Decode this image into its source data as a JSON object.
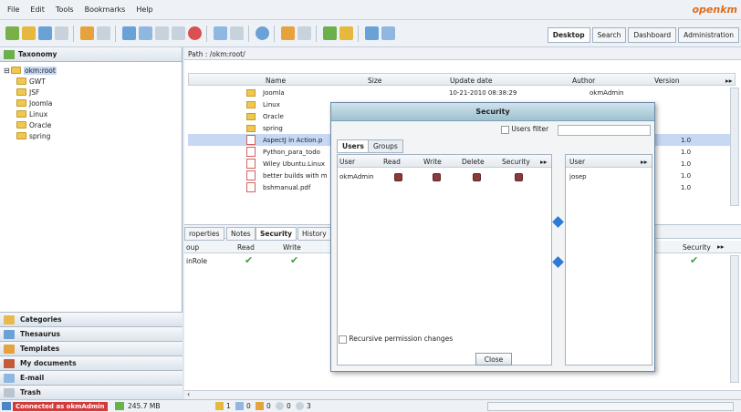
{
  "menu": [
    "File",
    "Edit",
    "Tools",
    "Bookmarks",
    "Help"
  ],
  "brand": "openkm",
  "top_tabs": [
    "Desktop",
    "Search",
    "Dashboard",
    "Administration"
  ],
  "left": {
    "taxonomy": "Taxonomy",
    "root": "okm:root",
    "folders": [
      "GWT",
      "JSF",
      "Joomla",
      "Linux",
      "Oracle",
      "spring"
    ],
    "accordion": [
      "Categories",
      "Thesaurus",
      "Templates",
      "My documents",
      "E-mail",
      "Trash"
    ]
  },
  "path": "Path : /okm:root/",
  "grid": {
    "headers": [
      "Name",
      "Size",
      "Update date",
      "Author",
      "Version"
    ],
    "rows": [
      {
        "name": "Joomla",
        "type": "folder",
        "date": "10-21-2010 08:38:29",
        "author": "okmAdmin",
        "version": ""
      },
      {
        "name": "Linux",
        "type": "folder",
        "date": "",
        "author": "",
        "version": ""
      },
      {
        "name": "Oracle",
        "type": "folder",
        "date": "",
        "author": "",
        "version": ""
      },
      {
        "name": "spring",
        "type": "folder",
        "date": "",
        "author": "",
        "version": ""
      },
      {
        "name": "AspectJ in Action.p",
        "type": "pdf",
        "date": "",
        "author": "",
        "version": "1.0"
      },
      {
        "name": "Python_para_todo",
        "type": "pdf",
        "date": "",
        "author": "",
        "version": "1.0"
      },
      {
        "name": "Wiley Ubuntu.Linux",
        "type": "pdf",
        "date": "",
        "author": "",
        "version": "1.0"
      },
      {
        "name": "better builds with m",
        "type": "pdf",
        "date": "",
        "author": "",
        "version": "1.0"
      },
      {
        "name": "bshmanual.pdf",
        "type": "pdf",
        "date": "",
        "author": "",
        "version": "1.0"
      }
    ]
  },
  "lower": {
    "tabs": [
      "roperties",
      "Notes",
      "Security",
      "History"
    ],
    "headers": [
      "oup",
      "Read",
      "Write",
      "Security"
    ],
    "row_label": "inRole"
  },
  "status": {
    "connected": "Connected as okmAdmin",
    "memory": "245.7 MB",
    "counts": [
      "1",
      "0",
      "0",
      "0",
      "3"
    ]
  },
  "dialog": {
    "title": "Security",
    "users_filter": "Users filter",
    "tabs": [
      "Users",
      "Groups"
    ],
    "left_headers": [
      "User",
      "Read",
      "Write",
      "Delete",
      "Security"
    ],
    "right_header": "User",
    "user_row": "okmAdmin",
    "right_user": "josep",
    "recursive": "Recursive permission changes",
    "close": "Close"
  },
  "colors": {
    "accent": "#e06a1a",
    "connected_bg": "#d23b3b"
  }
}
